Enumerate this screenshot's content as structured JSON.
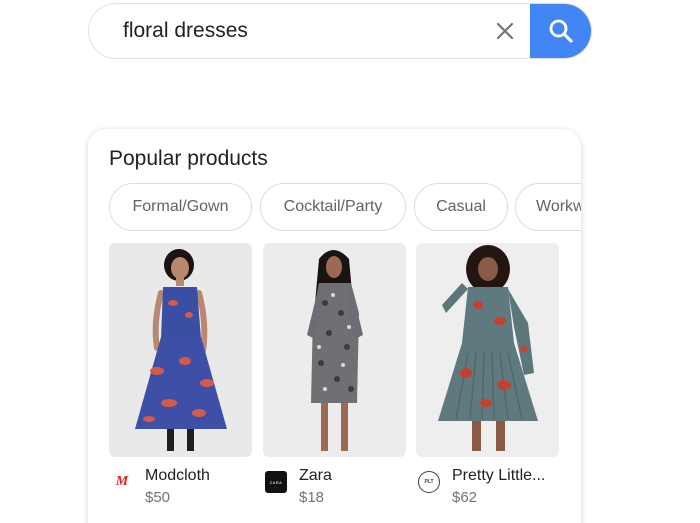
{
  "search": {
    "query": "floral dresses",
    "clear_icon": "close-icon",
    "search_icon": "search-icon",
    "accent_color": "#4285f4"
  },
  "popular_products": {
    "title": "Popular products",
    "chips": [
      "Formal/Gown",
      "Cocktail/Party",
      "Casual",
      "Workw"
    ],
    "items": [
      {
        "merchant": "Modcloth",
        "price": "$50",
        "logo_icon": "modcloth-logo-icon",
        "logo_text": "M"
      },
      {
        "merchant": "Zara",
        "price": "$18",
        "logo_icon": "zara-logo-icon",
        "logo_text": "ZARA"
      },
      {
        "merchant": "Pretty Little...",
        "price": "$62",
        "logo_icon": "prettylittlething-logo-icon",
        "logo_text": "PLT"
      }
    ]
  }
}
